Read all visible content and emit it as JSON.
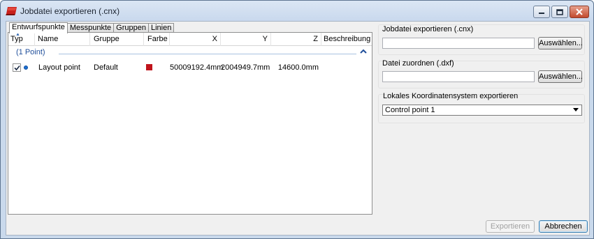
{
  "window": {
    "title": "Jobdatei exportieren (.cnx)"
  },
  "tabs": [
    "Entwurfspunkte",
    "Messpunkte",
    "Gruppen",
    "Linien"
  ],
  "grid": {
    "columns": {
      "typ": "Typ",
      "name": "Name",
      "gruppe": "Gruppe",
      "farbe": "Farbe",
      "x": "X",
      "y": "Y",
      "z": "Z",
      "beschreibung": "Beschreibung"
    },
    "group_label": "(1 Point)",
    "rows": [
      {
        "checked": true,
        "name": "Layout point",
        "gruppe": "Default",
        "farbe": "#c0141c",
        "x": "50009192.4mm",
        "y": "2004949.7mm",
        "z": "14600.0mm",
        "beschreibung": ""
      }
    ]
  },
  "export_cnx": {
    "title": "Jobdatei exportieren (.cnx)",
    "value": "",
    "button": "Auswählen..."
  },
  "assign_dxf": {
    "title": "Datei zuordnen (.dxf)",
    "value": "",
    "button": "Auswählen..."
  },
  "coord_system": {
    "title": "Lokales Koordinatensystem exportieren",
    "selected": "Control point 1"
  },
  "footer": {
    "export_button": "Exportieren",
    "cancel_button": "Abbrechen"
  },
  "colors": {
    "accent": "#1f4e9a",
    "point_color": "#c0141c"
  }
}
